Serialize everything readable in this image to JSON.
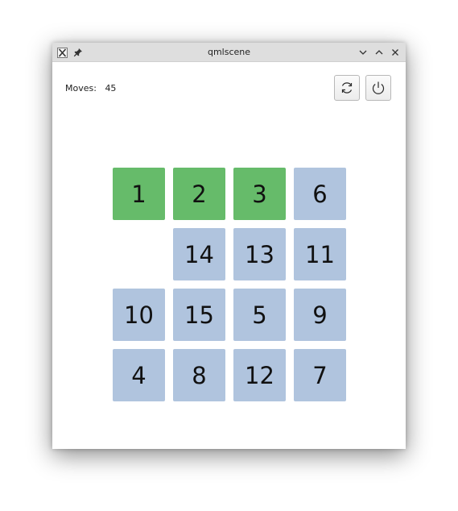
{
  "window": {
    "title": "qmlscene"
  },
  "header": {
    "moves_label": "Moves:",
    "moves_value": "45"
  },
  "colors": {
    "correct_tile": "#66bb6a",
    "normal_tile": "#b0c4de",
    "titlebar": "#dedede"
  },
  "board": {
    "rows": [
      [
        {
          "value": "1",
          "state": "correct"
        },
        {
          "value": "2",
          "state": "correct"
        },
        {
          "value": "3",
          "state": "correct"
        },
        {
          "value": "6",
          "state": "normal"
        }
      ],
      [
        {
          "value": "",
          "state": "empty"
        },
        {
          "value": "14",
          "state": "normal"
        },
        {
          "value": "13",
          "state": "normal"
        },
        {
          "value": "11",
          "state": "normal"
        }
      ],
      [
        {
          "value": "10",
          "state": "normal"
        },
        {
          "value": "15",
          "state": "normal"
        },
        {
          "value": "5",
          "state": "normal"
        },
        {
          "value": "9",
          "state": "normal"
        }
      ],
      [
        {
          "value": "4",
          "state": "normal"
        },
        {
          "value": "8",
          "state": "normal"
        },
        {
          "value": "12",
          "state": "normal"
        },
        {
          "value": "7",
          "state": "normal"
        }
      ]
    ]
  },
  "icons": {
    "app": "x-app-icon",
    "pin": "pin-icon",
    "minimize": "chevron-down-icon",
    "maximize": "chevron-up-icon",
    "close": "close-icon",
    "refresh": "refresh-icon",
    "power": "power-icon"
  }
}
